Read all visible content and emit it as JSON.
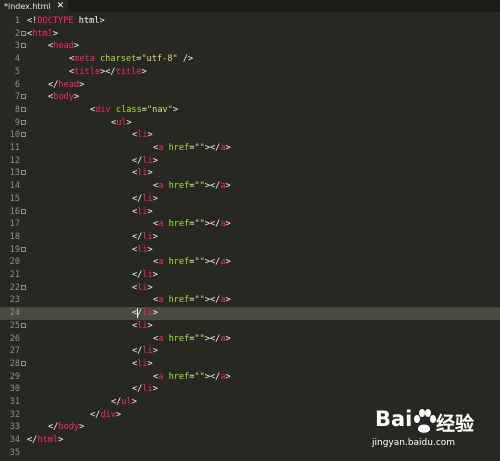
{
  "tab": {
    "title": "*index.html",
    "close": "✕"
  },
  "current_line": 24,
  "fold_lines": [
    2,
    3,
    7,
    8,
    9,
    10,
    13,
    16,
    19,
    22,
    25,
    28
  ],
  "lines": [
    {
      "n": "1",
      "indent": 0,
      "tokens": [
        [
          "pun",
          "<!"
        ],
        [
          "tag",
          "DOCTYPE"
        ],
        [
          "pun",
          " html>"
        ]
      ]
    },
    {
      "n": "2",
      "indent": 0,
      "tokens": [
        [
          "pun",
          "<"
        ],
        [
          "tag",
          "html"
        ],
        [
          "pun",
          ">"
        ]
      ]
    },
    {
      "n": "3",
      "indent": 4,
      "tokens": [
        [
          "pun",
          "<"
        ],
        [
          "tag",
          "head"
        ],
        [
          "pun",
          ">"
        ]
      ]
    },
    {
      "n": "4",
      "indent": 8,
      "tokens": [
        [
          "pun",
          "<"
        ],
        [
          "tag",
          "meta"
        ],
        [
          "pun",
          " "
        ],
        [
          "attr",
          "charset"
        ],
        [
          "pun",
          "="
        ],
        [
          "str",
          "\"utf-8\""
        ],
        [
          "pun",
          " />"
        ]
      ]
    },
    {
      "n": "5",
      "indent": 8,
      "tokens": [
        [
          "pun",
          "<"
        ],
        [
          "tag",
          "title"
        ],
        [
          "pun",
          "></"
        ],
        [
          "tag",
          "title"
        ],
        [
          "pun",
          ">"
        ]
      ]
    },
    {
      "n": "6",
      "indent": 4,
      "tokens": [
        [
          "pun",
          "</"
        ],
        [
          "tag",
          "head"
        ],
        [
          "pun",
          ">"
        ]
      ]
    },
    {
      "n": "7",
      "indent": 4,
      "tokens": [
        [
          "pun",
          "<"
        ],
        [
          "tag",
          "body"
        ],
        [
          "pun",
          ">"
        ]
      ]
    },
    {
      "n": "8",
      "indent": 12,
      "tokens": [
        [
          "pun",
          "<"
        ],
        [
          "tag",
          "div"
        ],
        [
          "pun",
          " "
        ],
        [
          "attr",
          "class"
        ],
        [
          "pun",
          "="
        ],
        [
          "str",
          "\"nav\""
        ],
        [
          "pun",
          ">"
        ]
      ]
    },
    {
      "n": "9",
      "indent": 16,
      "tokens": [
        [
          "pun",
          "<"
        ],
        [
          "tag",
          "ul"
        ],
        [
          "pun",
          ">"
        ]
      ]
    },
    {
      "n": "10",
      "indent": 20,
      "tokens": [
        [
          "pun",
          "<"
        ],
        [
          "tag",
          "li"
        ],
        [
          "pun",
          ">"
        ]
      ]
    },
    {
      "n": "11",
      "indent": 24,
      "tokens": [
        [
          "pun",
          "<"
        ],
        [
          "tag",
          "a"
        ],
        [
          "pun",
          " "
        ],
        [
          "attr",
          "href"
        ],
        [
          "pun",
          "="
        ],
        [
          "str",
          "\"\""
        ],
        [
          "pun",
          "></"
        ],
        [
          "tag",
          "a"
        ],
        [
          "pun",
          ">"
        ]
      ]
    },
    {
      "n": "12",
      "indent": 20,
      "tokens": [
        [
          "pun",
          "</"
        ],
        [
          "tag",
          "li"
        ],
        [
          "pun",
          ">"
        ]
      ]
    },
    {
      "n": "13",
      "indent": 20,
      "tokens": [
        [
          "pun",
          "<"
        ],
        [
          "tag",
          "li"
        ],
        [
          "pun",
          ">"
        ]
      ]
    },
    {
      "n": "14",
      "indent": 24,
      "tokens": [
        [
          "pun",
          "<"
        ],
        [
          "tag",
          "a"
        ],
        [
          "pun",
          " "
        ],
        [
          "attr",
          "href"
        ],
        [
          "pun",
          "="
        ],
        [
          "str",
          "\"\""
        ],
        [
          "pun",
          "></"
        ],
        [
          "tag",
          "a"
        ],
        [
          "pun",
          ">"
        ]
      ]
    },
    {
      "n": "15",
      "indent": 20,
      "tokens": [
        [
          "pun",
          "</"
        ],
        [
          "tag",
          "li"
        ],
        [
          "pun",
          ">"
        ]
      ]
    },
    {
      "n": "16",
      "indent": 20,
      "tokens": [
        [
          "pun",
          "<"
        ],
        [
          "tag",
          "li"
        ],
        [
          "pun",
          ">"
        ]
      ]
    },
    {
      "n": "17",
      "indent": 24,
      "tokens": [
        [
          "pun",
          "<"
        ],
        [
          "tag",
          "a"
        ],
        [
          "pun",
          " "
        ],
        [
          "attr",
          "href"
        ],
        [
          "pun",
          "="
        ],
        [
          "str",
          "\"\""
        ],
        [
          "pun",
          "></"
        ],
        [
          "tag",
          "a"
        ],
        [
          "pun",
          ">"
        ]
      ]
    },
    {
      "n": "18",
      "indent": 20,
      "tokens": [
        [
          "pun",
          "</"
        ],
        [
          "tag",
          "li"
        ],
        [
          "pun",
          ">"
        ]
      ]
    },
    {
      "n": "19",
      "indent": 20,
      "tokens": [
        [
          "pun",
          "<"
        ],
        [
          "tag",
          "li"
        ],
        [
          "pun",
          ">"
        ]
      ]
    },
    {
      "n": "20",
      "indent": 24,
      "tokens": [
        [
          "pun",
          "<"
        ],
        [
          "tag",
          "a"
        ],
        [
          "pun",
          " "
        ],
        [
          "attr",
          "href"
        ],
        [
          "pun",
          "="
        ],
        [
          "str",
          "\"\""
        ],
        [
          "pun",
          "></"
        ],
        [
          "tag",
          "a"
        ],
        [
          "pun",
          ">"
        ]
      ]
    },
    {
      "n": "21",
      "indent": 20,
      "tokens": [
        [
          "pun",
          "</"
        ],
        [
          "tag",
          "li"
        ],
        [
          "pun",
          ">"
        ]
      ]
    },
    {
      "n": "22",
      "indent": 20,
      "tokens": [
        [
          "pun",
          "<"
        ],
        [
          "tag",
          "li"
        ],
        [
          "pun",
          ">"
        ]
      ]
    },
    {
      "n": "23",
      "indent": 24,
      "tokens": [
        [
          "pun",
          "<"
        ],
        [
          "tag",
          "a"
        ],
        [
          "pun",
          " "
        ],
        [
          "attr",
          "href"
        ],
        [
          "pun",
          "="
        ],
        [
          "str",
          "\"\""
        ],
        [
          "pun",
          "></"
        ],
        [
          "tag",
          "a"
        ],
        [
          "pun",
          ">"
        ]
      ]
    },
    {
      "n": "24",
      "indent": 20,
      "tokens": [
        [
          "pun",
          "</"
        ],
        [
          "tag",
          "li"
        ],
        [
          "pun",
          ">"
        ]
      ]
    },
    {
      "n": "25",
      "indent": 20,
      "tokens": [
        [
          "pun",
          "<"
        ],
        [
          "tag",
          "li"
        ],
        [
          "pun",
          ">"
        ]
      ]
    },
    {
      "n": "26",
      "indent": 24,
      "tokens": [
        [
          "pun",
          "<"
        ],
        [
          "tag",
          "a"
        ],
        [
          "pun",
          " "
        ],
        [
          "attr",
          "href"
        ],
        [
          "pun",
          "="
        ],
        [
          "str",
          "\"\""
        ],
        [
          "pun",
          "></"
        ],
        [
          "tag",
          "a"
        ],
        [
          "pun",
          ">"
        ]
      ]
    },
    {
      "n": "27",
      "indent": 20,
      "tokens": [
        [
          "pun",
          "</"
        ],
        [
          "tag",
          "li"
        ],
        [
          "pun",
          ">"
        ]
      ]
    },
    {
      "n": "28",
      "indent": 20,
      "tokens": [
        [
          "pun",
          "<"
        ],
        [
          "tag",
          "li"
        ],
        [
          "pun",
          ">"
        ]
      ]
    },
    {
      "n": "29",
      "indent": 24,
      "tokens": [
        [
          "pun",
          "<"
        ],
        [
          "tag",
          "a"
        ],
        [
          "pun",
          " "
        ],
        [
          "attr",
          "href"
        ],
        [
          "pun",
          "="
        ],
        [
          "str",
          "\"\""
        ],
        [
          "pun",
          "></"
        ],
        [
          "tag",
          "a"
        ],
        [
          "pun",
          ">"
        ]
      ]
    },
    {
      "n": "30",
      "indent": 20,
      "tokens": [
        [
          "pun",
          "</"
        ],
        [
          "tag",
          "li"
        ],
        [
          "pun",
          ">"
        ]
      ]
    },
    {
      "n": "31",
      "indent": 16,
      "tokens": [
        [
          "pun",
          "</"
        ],
        [
          "tag",
          "ul"
        ],
        [
          "pun",
          ">"
        ]
      ]
    },
    {
      "n": "32",
      "indent": 12,
      "tokens": [
        [
          "pun",
          "</"
        ],
        [
          "tag",
          "div"
        ],
        [
          "pun",
          ">"
        ]
      ]
    },
    {
      "n": "33",
      "indent": 4,
      "tokens": [
        [
          "pun",
          "</"
        ],
        [
          "tag",
          "body"
        ],
        [
          "pun",
          ">"
        ]
      ]
    },
    {
      "n": "34",
      "indent": 0,
      "tokens": [
        [
          "pun",
          "</"
        ],
        [
          "tag",
          "html"
        ],
        [
          "pun",
          ">"
        ]
      ]
    },
    {
      "n": "35",
      "indent": 0,
      "tokens": []
    }
  ],
  "watermark": {
    "brand_left": "Bai",
    "brand_right": "经验",
    "url": "jingyan.baidu.com"
  },
  "colors": {
    "background": "#272822",
    "tag": "#f92672",
    "attribute": "#a6e22e",
    "string": "#e6db74",
    "text": "#f8f8f2",
    "gutter": "#8f908a",
    "current_line": "#4a4b3e"
  }
}
